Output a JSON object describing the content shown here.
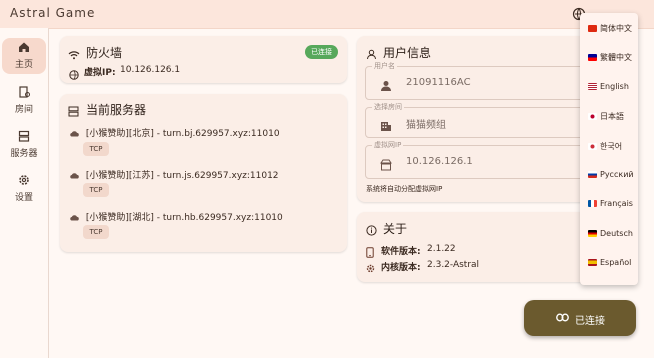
{
  "app": {
    "title": "Astral Game"
  },
  "sidebar": {
    "items": [
      {
        "label": "主页",
        "icon": "home-icon",
        "active": true
      },
      {
        "label": "房间",
        "icon": "room-icon"
      },
      {
        "label": "服务器",
        "icon": "server-icon"
      },
      {
        "label": "设置",
        "icon": "gear-icon"
      }
    ]
  },
  "firewall": {
    "title": "防火墙",
    "status": "已连接",
    "ip_label": "虚拟IP:",
    "ip_value": "10.126.126.1"
  },
  "servers": {
    "title": "当前服务器",
    "items": [
      {
        "name": "[小猴赞助][北京] - turn.bj.629957.xyz:11010",
        "protocol": "TCP"
      },
      {
        "name": "[小猴赞助][江苏] - turn.js.629957.xyz:11012",
        "protocol": "TCP"
      },
      {
        "name": "[小猴赞助][湖北] - turn.hb.629957.xyz:11010",
        "protocol": "TCP"
      }
    ]
  },
  "user_info": {
    "title": "用户信息",
    "fields": [
      {
        "label": "用户名",
        "value": "21091116AC"
      },
      {
        "label": "选择房间",
        "value": "猫猫频组"
      },
      {
        "label": "虚拟网IP",
        "value": "10.126.126.1"
      }
    ],
    "note": "系统将自动分配虚拟网IP"
  },
  "about": {
    "title": "关于",
    "software_label": "软件版本:",
    "software_version": "2.1.22",
    "kernel_label": "内核版本:",
    "kernel_version": "2.3.2-Astral"
  },
  "languages": [
    {
      "label": "简体中文",
      "flag": "cn"
    },
    {
      "label": "繁體中文",
      "flag": "tw"
    },
    {
      "label": "English",
      "flag": "us"
    },
    {
      "label": "日本語",
      "flag": "jp"
    },
    {
      "label": "한국어",
      "flag": "kr"
    },
    {
      "label": "Русский",
      "flag": "ru"
    },
    {
      "label": "Français",
      "flag": "fr"
    },
    {
      "label": "Deutsch",
      "flag": "de"
    },
    {
      "label": "Español",
      "flag": "es"
    }
  ],
  "connect_button": {
    "label": "已连接"
  },
  "colors": {
    "accent": "#6B5A2E",
    "status_green": "#57A85B",
    "background": "#FFF8F4"
  }
}
